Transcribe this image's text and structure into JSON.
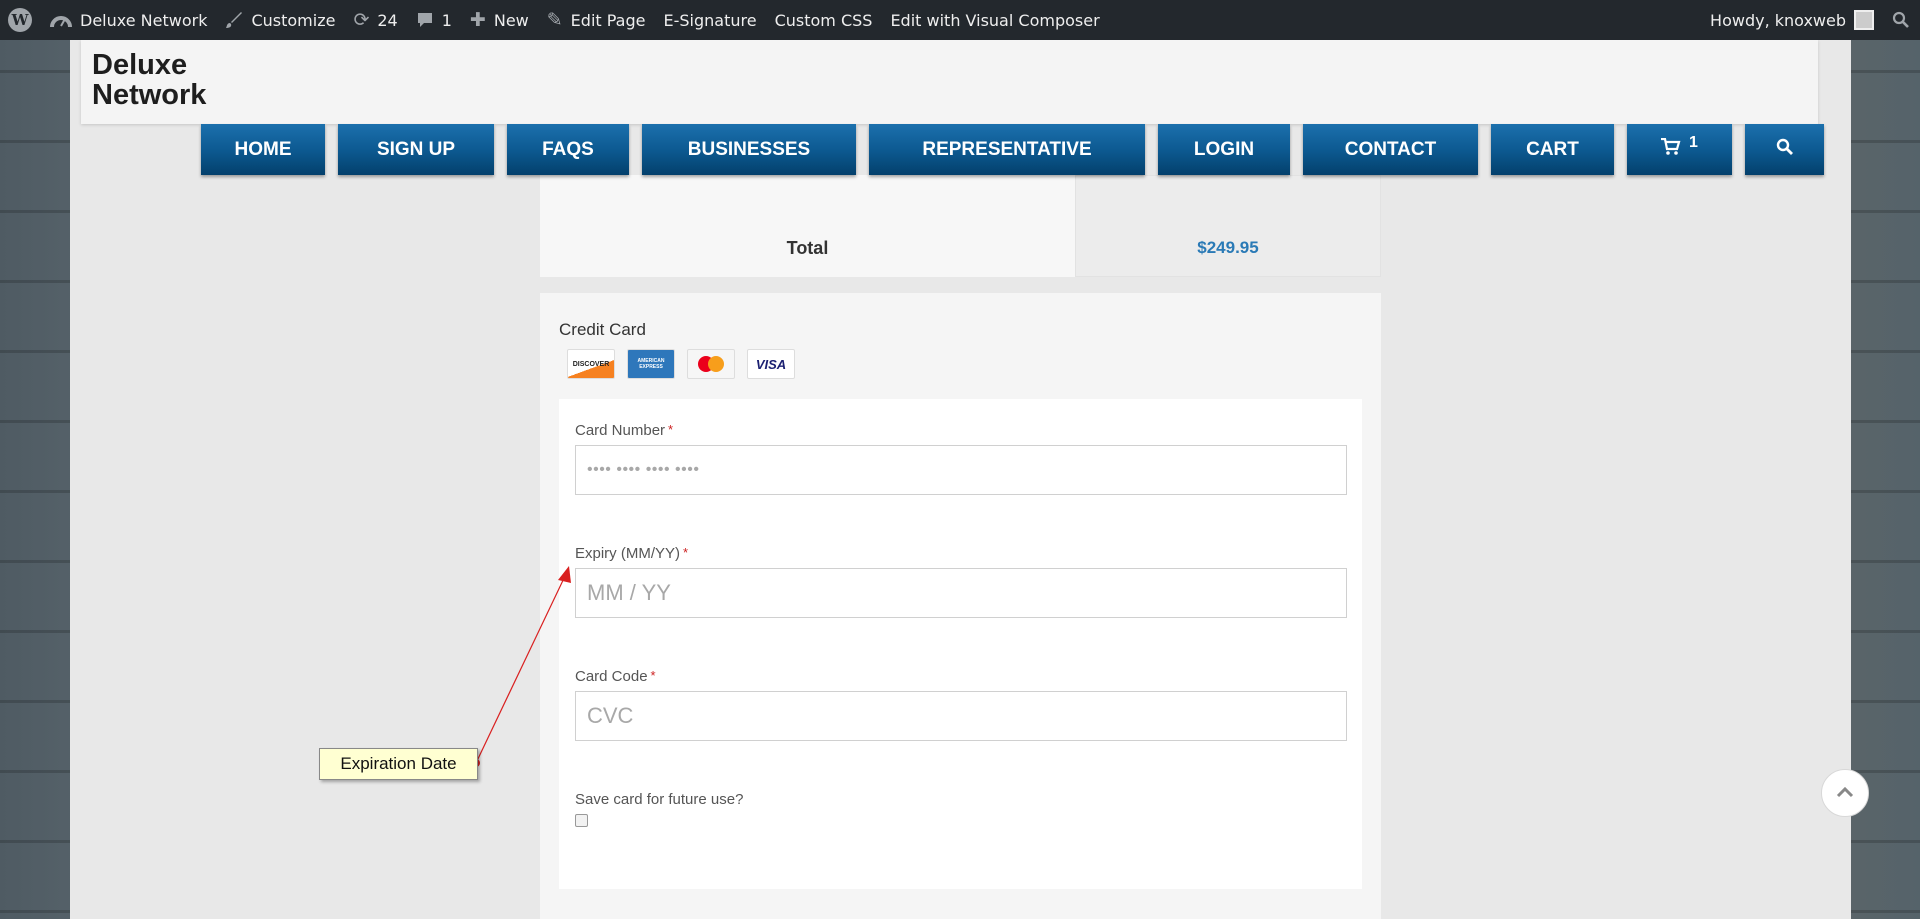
{
  "adminbar": {
    "site_name": "Deluxe Network",
    "customize": "Customize",
    "updates_count": "24",
    "comments_count": "1",
    "new": "New",
    "edit_page": "Edit Page",
    "esignature": "E-Signature",
    "custom_css": "Custom CSS",
    "visual_composer": "Edit with Visual Composer",
    "howdy": "Howdy, knoxweb"
  },
  "site": {
    "title_line1": "Deluxe",
    "title_line2": "Network"
  },
  "nav": {
    "items": [
      "HOME",
      "SIGN UP",
      "FAQS",
      "BUSINESSES",
      "REPRESENTATIVE",
      "LOGIN",
      "CONTACT",
      "CART"
    ],
    "cart_count": "1"
  },
  "order": {
    "total_label": "Total",
    "total_value": "$249.95"
  },
  "payment": {
    "title": "Credit Card",
    "card_logos": [
      "DISCOVER",
      "AMERICAN EXPRESS",
      "MasterCard",
      "VISA"
    ],
    "card_number_label": "Card Number",
    "card_number_placeholder": "•••• •••• •••• ••••",
    "expiry_label": "Expiry (MM/YY)",
    "expiry_placeholder": "MM / YY",
    "card_code_label": "Card Code",
    "card_code_placeholder": "CVC",
    "save_card_label": "Save card for future use?",
    "required_mark": "*"
  },
  "annotation": {
    "text": "Expiration Date"
  }
}
